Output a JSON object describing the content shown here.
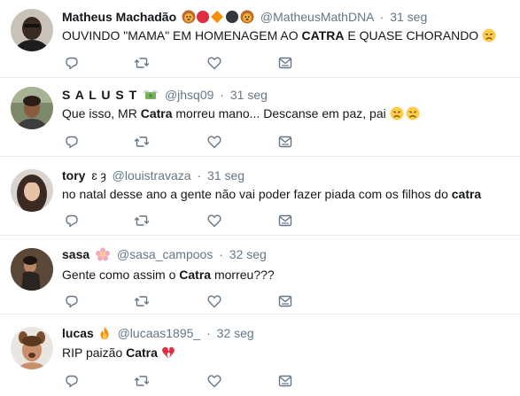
{
  "colors": {
    "text": "#14171a",
    "meta": "#657786",
    "border": "#e6ecf0",
    "icon": "#657786"
  },
  "tweets": [
    {
      "name": "Matheus Machadão",
      "name_emojis": [
        "lion-face-icon",
        "red-circle-icon",
        "orange-diamond-icon",
        "black-circle-icon",
        "lion-face-icon"
      ],
      "handle": "@MatheusMathDNA",
      "sep": "·",
      "time": "31 seg",
      "text_before": "OUVINDO \"MAMA\" EM HOMENAGEM AO ",
      "text_bold": "CATRA",
      "text_after": " E QUASE CHORANDO ",
      "text_emoji": "disappointed-face-icon"
    },
    {
      "name": "S A L U S T",
      "name_emojis": [
        "money-with-wings-icon"
      ],
      "handle": "@jhsq09",
      "sep": "·",
      "time": "31 seg",
      "text_before": "Que isso, MR ",
      "text_bold": "Catra",
      "text_after": " morreu mano... Descanse em paz, pai ",
      "text_emoji": "disappointed-face-double-icon"
    },
    {
      "name": "tory",
      "name_suffix": "ɛ ȝ",
      "handle": "@louistravaza",
      "sep": "·",
      "time": "31 seg",
      "text_before": "no natal desse ano a gente não vai poder fazer piada com os filhos do ",
      "text_bold": "catra",
      "text_after": ""
    },
    {
      "name": "sasa",
      "name_emojis": [
        "cherry-blossom-icon"
      ],
      "handle": "@sasa_campoos",
      "sep": "·",
      "time": "32 seg",
      "text_before": "Gente como assim o ",
      "text_bold": "Catra",
      "text_after": " morreu???"
    },
    {
      "name": "lucas",
      "name_emojis": [
        "fire-icon"
      ],
      "handle": "@lucaas1895_",
      "sep": "·",
      "time": "32 seg",
      "text_before": "RIP paizão ",
      "text_bold": "Catra",
      "text_after": " ",
      "text_emoji": "broken-heart-icon"
    }
  ],
  "actions": [
    "reply-icon",
    "retweet-icon",
    "like-icon",
    "direct-message-icon"
  ]
}
